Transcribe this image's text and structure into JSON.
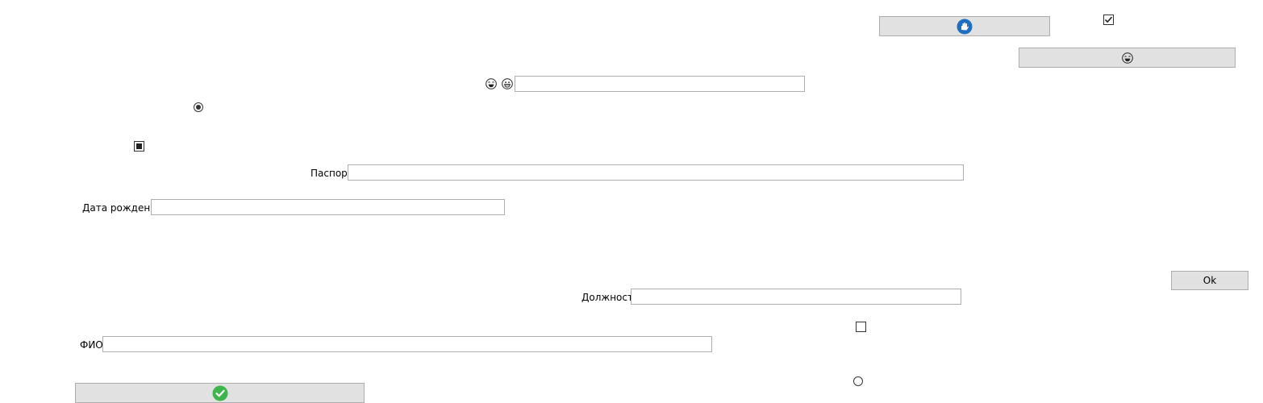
{
  "labels": {
    "passport": "Паспорт",
    "birth_date": "Дата рождения",
    "position": "Должность",
    "fio": "ФИО"
  },
  "buttons": {
    "ok": "Ok"
  },
  "fields": {
    "emoji_input": "",
    "passport": "",
    "birth_date": "",
    "position": "",
    "fio": ""
  },
  "controls": {
    "top_checkbox_checked": true,
    "radio_left_selected": true,
    "square_checkbox_indeterminate": true,
    "right_checkbox_checked": false,
    "right_radio_selected": false
  },
  "icons": {
    "top_button": "blue-hand-icon",
    "second_button": "laughing-face-icon",
    "emoji_1": "laughing-face-icon",
    "emoji_2": "grinning-face-icon",
    "bottom_button": "green-checkmark-icon"
  },
  "colors": {
    "button_bg": "#e1e1e1",
    "button_border": "#adadad",
    "field_border": "#abadb3",
    "icon_blue": "#1e6fc2",
    "icon_green": "#3cb54a"
  }
}
